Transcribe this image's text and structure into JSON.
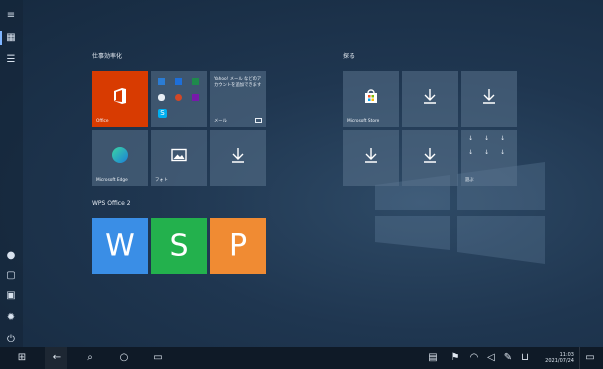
{
  "groups": {
    "group1_label": "仕事効率化",
    "group2_label": "探る",
    "group3_label": "WPS Office 2"
  },
  "tiles": {
    "office_label": "Office",
    "office_apps_badge": "S",
    "mail_text": "Yahoo! メール などのアカウントを追加できます",
    "mail_label": "メール",
    "edge_label": "Microsoft Edge",
    "photos_label": "フォト",
    "store_label": "Microsoft Store",
    "play_label": "遊ぶ"
  },
  "wps": {
    "w_label": "W",
    "s_label": "S",
    "p_label": "P"
  },
  "taskbar": {
    "time": "11:03",
    "date": "2021/07/24"
  },
  "colors": {
    "office_red": "#d83b01",
    "wps_blue": "#3a8ee6",
    "wps_green": "#23b14d",
    "wps_orange": "#f08b33"
  }
}
